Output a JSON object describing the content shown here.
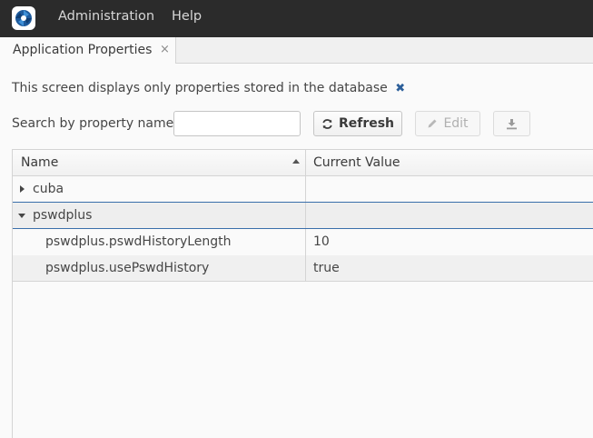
{
  "menubar": {
    "items": [
      "Administration",
      "Help"
    ]
  },
  "tab": {
    "title": "Application Properties",
    "close_glyph": "×"
  },
  "info": {
    "text": "This screen displays only properties stored in the database",
    "close_glyph": "✖"
  },
  "search": {
    "label": "Search by property name",
    "value": "",
    "placeholder": ""
  },
  "toolbar": {
    "refresh_label": "Refresh",
    "edit_label": "Edit",
    "export_icon": "download-icon"
  },
  "table": {
    "columns": [
      "Name",
      "Current Value"
    ],
    "rows": [
      {
        "name": "cuba",
        "value": ""
      },
      {
        "name": "pswdplus",
        "value": ""
      },
      {
        "name": "pswdplus.pswdHistoryLength",
        "value": "10"
      },
      {
        "name": "pswdplus.usePswdHistory",
        "value": "true"
      }
    ]
  },
  "colors": {
    "menubar": "#2b2b2b",
    "selection_border": "#3a6fab",
    "info_close": "#2c5f9a"
  }
}
